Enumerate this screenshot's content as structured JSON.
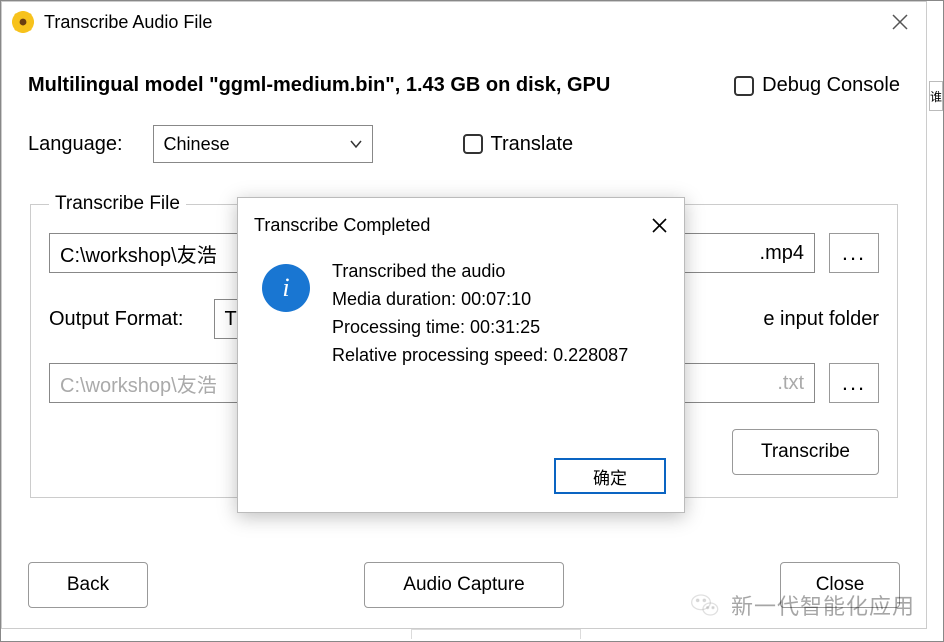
{
  "window": {
    "title": "Transcribe Audio File"
  },
  "header": {
    "model_description": "Multilingual model \"ggml-medium.bin\", 1.43 GB on disk, GPU",
    "debug_console_label": "Debug Console",
    "language_label": "Language:",
    "language_value": "Chinese",
    "translate_label": "Translate"
  },
  "group": {
    "legend": "Transcribe File",
    "input_path_left": "C:\\workshop\\友浩",
    "input_path_right": ".mp4",
    "output_format_label": "Output Format:",
    "output_format_value_fragment": "T",
    "save_folder_fragment": "e input folder",
    "output_path_left": "C:\\workshop\\友浩",
    "output_path_right": ".txt",
    "browse": "...",
    "transcribe_btn": "Transcribe"
  },
  "footer": {
    "back": "Back",
    "audio_capture": "Audio Capture",
    "close": "Close"
  },
  "modal": {
    "title": "Transcribe Completed",
    "line1": "Transcribed the audio",
    "line2": "Media duration: 00:07:10",
    "line3": "Processing time: 00:31:25",
    "line4": "Relative processing speed: 0.228087",
    "ok": "确定"
  },
  "scrap_text": "谁",
  "watermark": {
    "text": "新一代智能化应用"
  }
}
